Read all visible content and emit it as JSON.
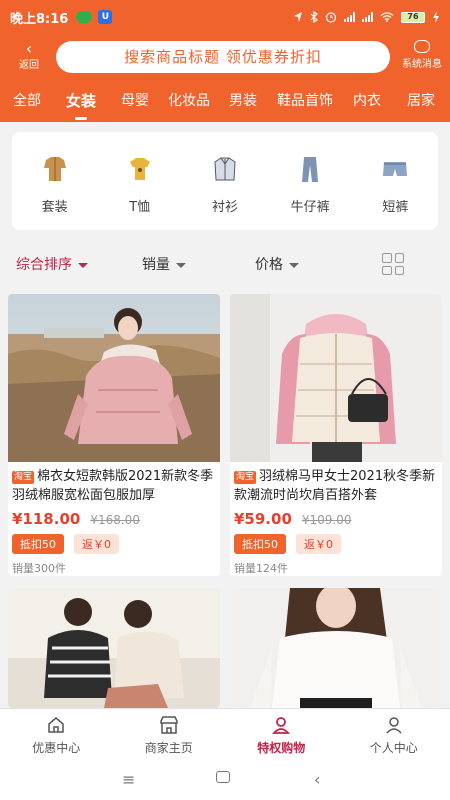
{
  "status": {
    "time": "晚上8:16",
    "battery": "76"
  },
  "topbar": {
    "back_label": "返回",
    "search_placeholder": "搜索商品标题 领优惠券折扣",
    "sysmsg_label": "系统消息"
  },
  "categories": [
    "全部",
    "女装",
    "母婴",
    "化妆品",
    "男装",
    "鞋品首饰",
    "内衣",
    "居家"
  ],
  "subcategories": [
    {
      "label": "套装",
      "icon": "suit-icon"
    },
    {
      "label": "T恤",
      "icon": "tshirt-icon"
    },
    {
      "label": "衬衫",
      "icon": "shirt-icon"
    },
    {
      "label": "牛仔裤",
      "icon": "jeans-icon"
    },
    {
      "label": "短裤",
      "icon": "shorts-icon"
    }
  ],
  "sort": {
    "comprehensive": "综合排序",
    "sales": "销量",
    "price": "价格"
  },
  "products": [
    {
      "badge": "淘宝",
      "title": "棉衣女短款韩版2021新款冬季羽绒棉服宽松面包服加厚",
      "price": "¥118.00",
      "original_price": "¥168.00",
      "coupon": "抵扣50",
      "rebate": "返￥0",
      "sold": "销量300件"
    },
    {
      "badge": "淘宝",
      "title": "羽绒棉马甲女士2021秋冬季新款潮流时尚坎肩百搭外套",
      "price": "¥59.00",
      "original_price": "¥109.00",
      "coupon": "抵扣50",
      "rebate": "返￥0",
      "sold": "销量124件"
    }
  ],
  "tabs": [
    {
      "label": "优惠中心",
      "icon": "home-icon"
    },
    {
      "label": "商家主页",
      "icon": "store-icon"
    },
    {
      "label": "特权购物",
      "icon": "user-icon"
    },
    {
      "label": "个人中心",
      "icon": "person-icon"
    }
  ],
  "colors": {
    "brand": "#f0632c",
    "accent": "#c0254a",
    "price": "#e8402f"
  }
}
